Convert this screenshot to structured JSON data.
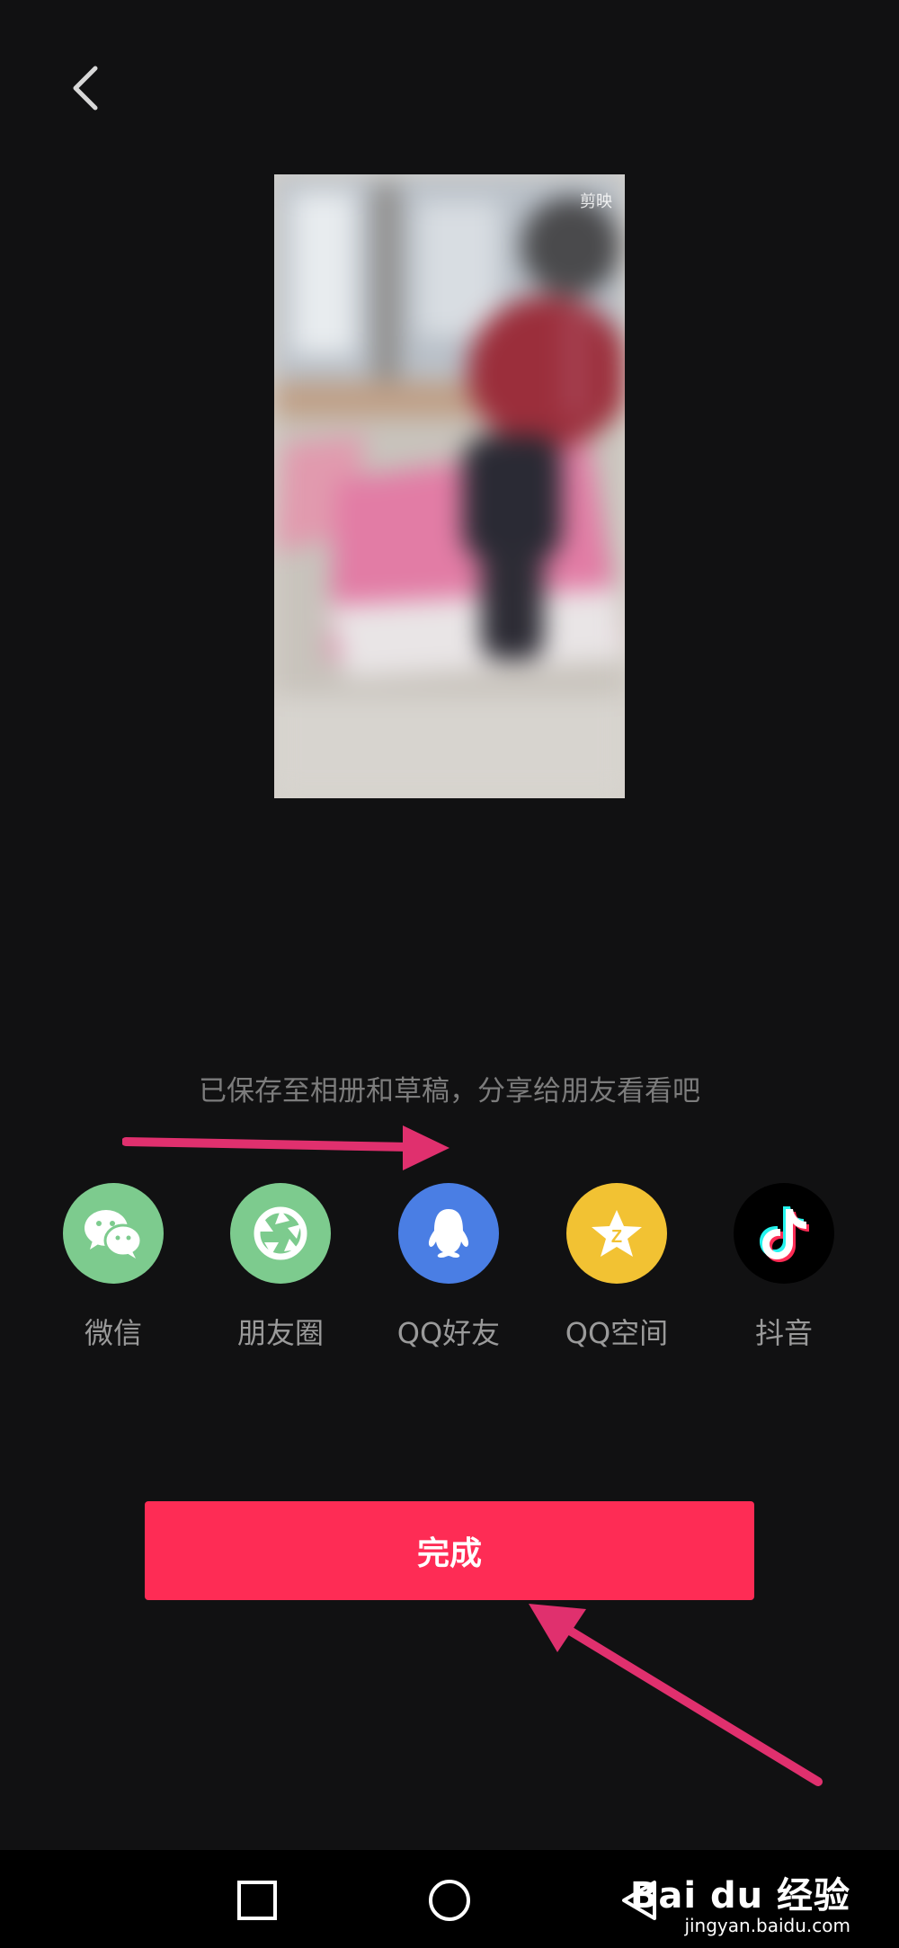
{
  "preview": {
    "watermark": "剪映"
  },
  "saved_message": "已保存至相册和草稿，分享给朋友看看吧",
  "share_targets": [
    {
      "label": "微信",
      "icon": "wechat-icon",
      "color": "#7dcb8e"
    },
    {
      "label": "朋友圈",
      "icon": "moments-icon",
      "color": "#7dcb8e"
    },
    {
      "label": "QQ好友",
      "icon": "qq-icon",
      "color": "#4a7ee4"
    },
    {
      "label": "QQ空间",
      "icon": "qzone-icon",
      "color": "#f2c233"
    },
    {
      "label": "抖音",
      "icon": "douyin-icon",
      "color": "#000000"
    }
  ],
  "done_button": {
    "label": "完成",
    "color": "#fe2c55"
  },
  "annotation_color": "#e0306e",
  "watermark_overlay": {
    "brand": "Bai du 经验",
    "url": "jingyan.baidu.com"
  }
}
